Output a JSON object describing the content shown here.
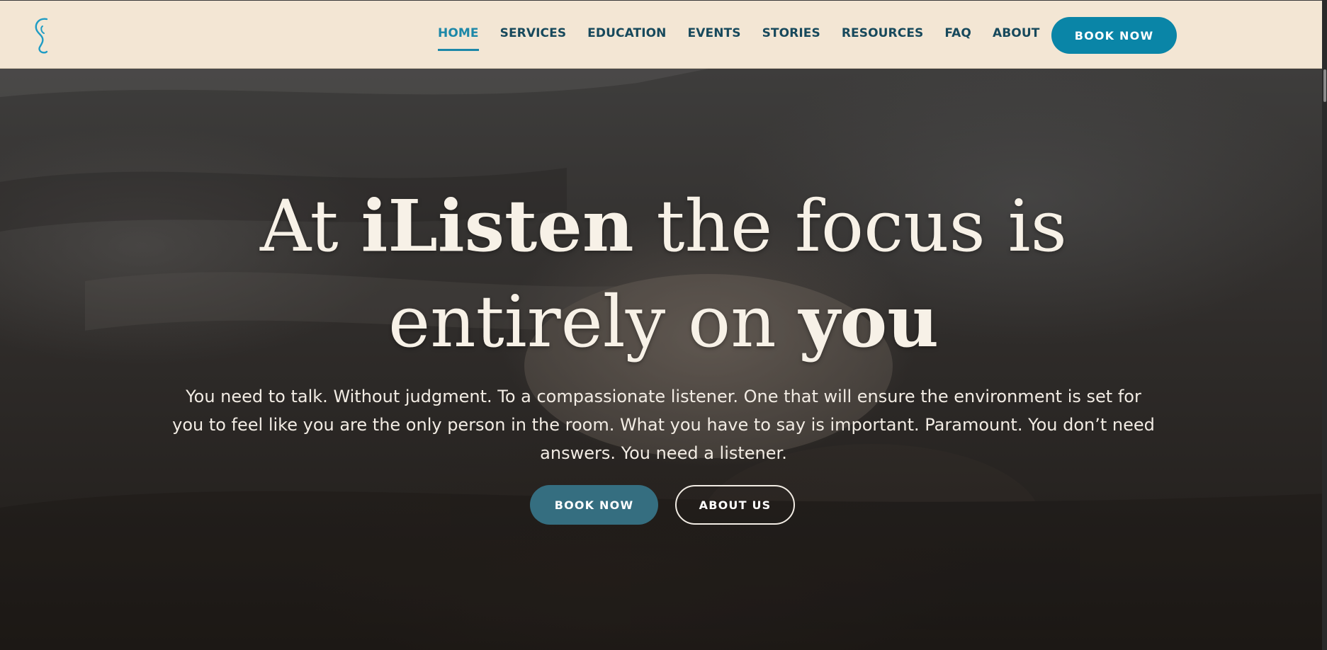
{
  "header": {
    "logo_icon": "ear-logo-icon",
    "nav": [
      {
        "label": "HOME",
        "active": true
      },
      {
        "label": "SERVICES"
      },
      {
        "label": "EDUCATION"
      },
      {
        "label": "EVENTS"
      },
      {
        "label": "STORIES"
      },
      {
        "label": "RESOURCES"
      },
      {
        "label": "FAQ"
      },
      {
        "label": "ABOUT"
      }
    ],
    "book_label": "BOOK NOW"
  },
  "hero": {
    "headline": {
      "part1": "At ",
      "brand": "iListen",
      "part2": " the focus is",
      "part3": "entirely on ",
      "emph": "you"
    },
    "subtext": "You need to talk. Without judgment. To a compassionate listener. One that will ensure the environment is set for you to feel like you are the only person in the room. What you have to say is important. Paramount. You don’t need answers. You need a listener.",
    "book_label": "BOOK NOW",
    "about_label": "ABOUT US"
  },
  "colors": {
    "header_bg": "#f3e6d4",
    "nav_text": "#17495c",
    "nav_active": "#1d88a8",
    "primary_button": "#0a85a7",
    "hero_button": "#356e80",
    "hero_text": "#f7f1e7"
  }
}
